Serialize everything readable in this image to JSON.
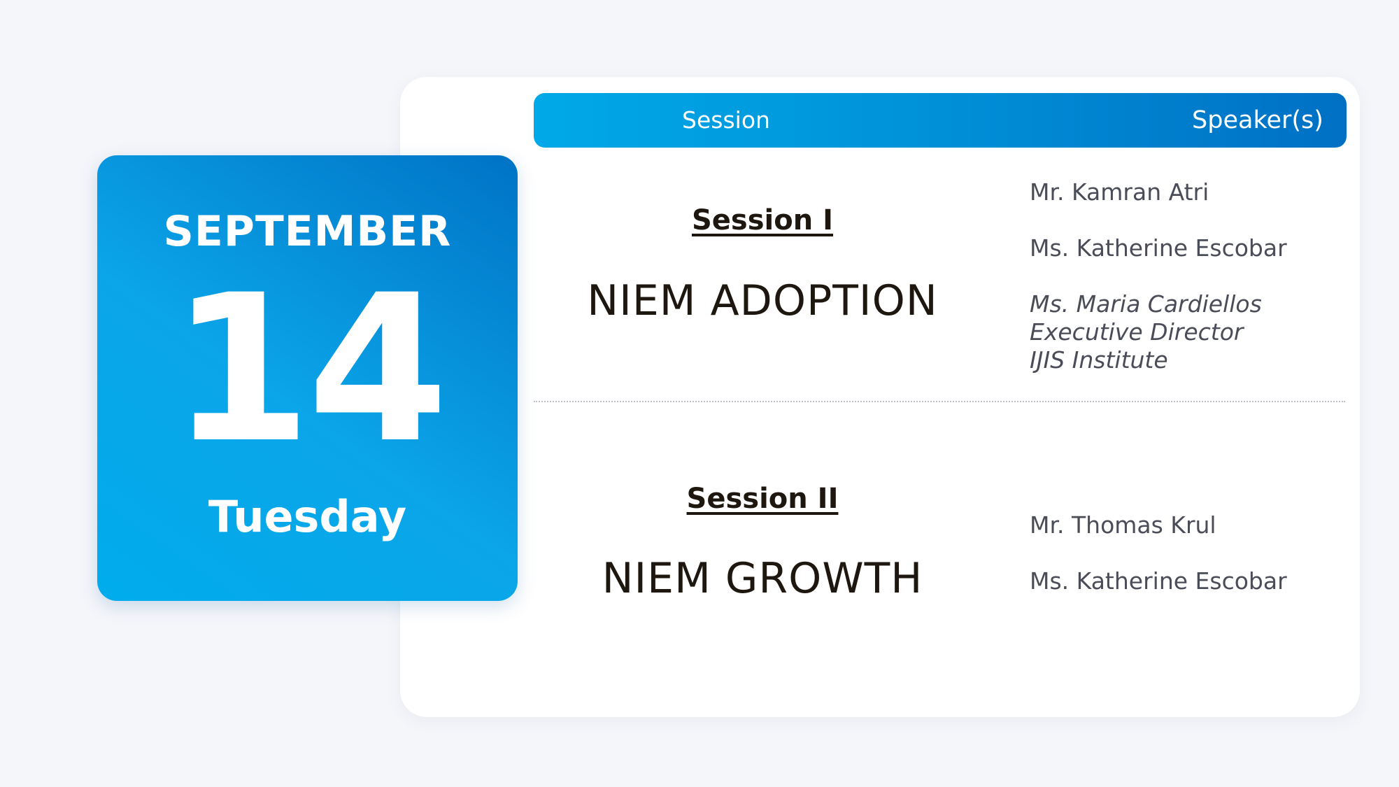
{
  "date": {
    "month": "SEPTEMBER",
    "day": "14",
    "weekday": "Tuesday"
  },
  "table": {
    "header": {
      "session": "Session",
      "speakers": "Speaker(s)"
    },
    "sessions": [
      {
        "label": "Session I",
        "title": "NIEM ADOPTION",
        "speakers": [
          "Mr. Kamran Atri",
          "Ms. Katherine Escobar"
        ],
        "featured_speaker": {
          "name": "Ms. Maria Cardiellos",
          "role": "Executive Director",
          "org": "IJIS Institute"
        }
      },
      {
        "label": "Session II",
        "title": "NIEM GROWTH",
        "speakers": [
          "Mr. Thomas Krul",
          "Ms. Katherine Escobar"
        ]
      }
    ]
  },
  "colors": {
    "background": "#f5f6fa",
    "accent_start": "#00acec",
    "accent_end": "#0070c4",
    "title_text": "#1e170f",
    "speaker_text": "#4a4c58"
  }
}
